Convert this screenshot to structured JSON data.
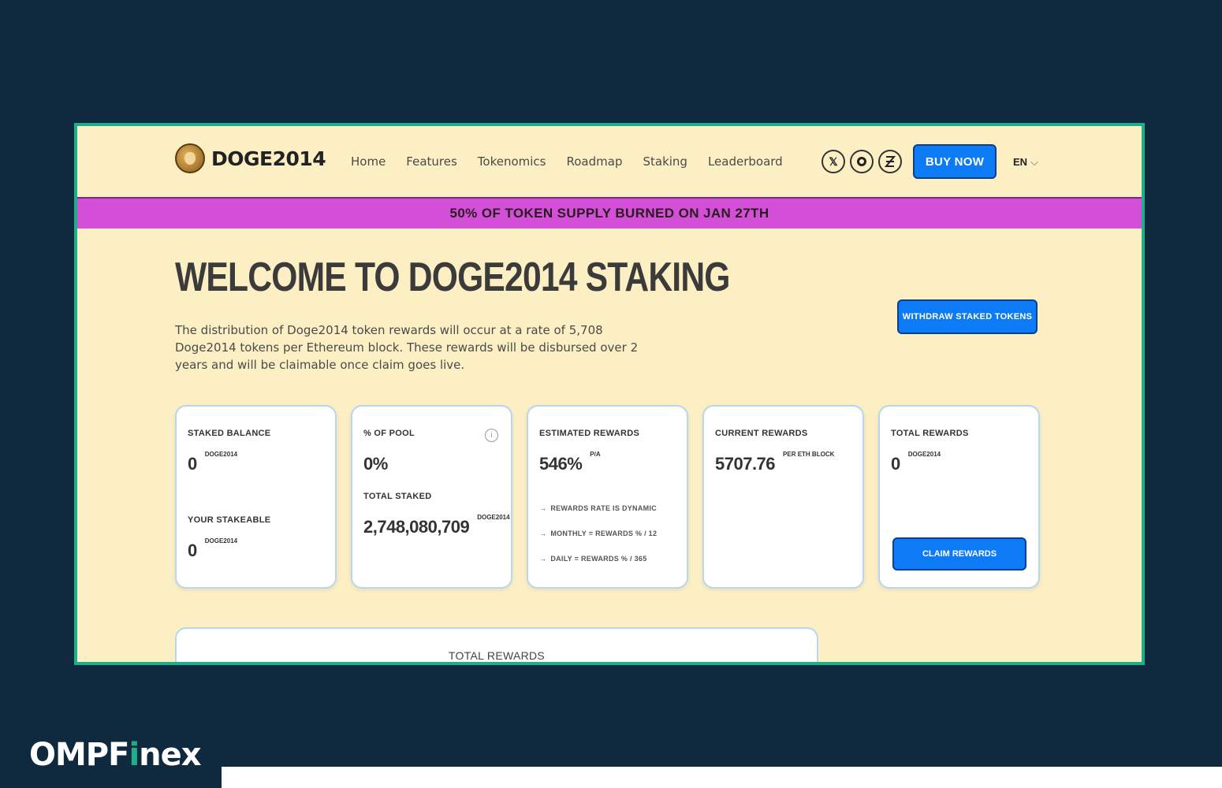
{
  "brand": {
    "logo_text": "DOGE2014"
  },
  "nav": {
    "items": [
      "Home",
      "Features",
      "Tokenomics",
      "Roadmap",
      "Staking",
      "Leaderboard"
    ]
  },
  "socials": [
    "x-icon",
    "coin-icon",
    "logo-icon"
  ],
  "header": {
    "buy_label": "BUY NOW",
    "language": "EN"
  },
  "banner": {
    "text": "50% OF TOKEN SUPPLY BURNED ON JAN 27TH"
  },
  "main": {
    "title": "WELCOME TO DOGE2014 STAKING",
    "description": "The distribution of Doge2014 token rewards will occur at a rate of 5,708 Doge2014 tokens per Ethereum block. These rewards will be disbursed over 2 years and will be claimable once claim goes live.",
    "withdraw_label": "WITHDRAW STAKED TOKENS"
  },
  "cards": {
    "staked": {
      "label": "STAKED BALANCE",
      "value": "0",
      "unit": "DOGE2014",
      "label2": "YOUR STAKEABLE",
      "value2": "0",
      "unit2": "DOGE2014"
    },
    "pool": {
      "label": "% OF POOL",
      "value": "0%",
      "label2": "TOTAL STAKED",
      "value2": "2,748,080,709",
      "unit2": "DOGE2014"
    },
    "estimated": {
      "label": "ESTIMATED REWARDS",
      "value": "546%",
      "unit": "P/A",
      "bullets": [
        "REWARDS RATE IS DYNAMIC",
        "MONTHLY = REWARDS % / 12",
        "DAILY = REWARDS % / 365"
      ]
    },
    "current": {
      "label": "CURRENT REWARDS",
      "value": "5707.76",
      "unit": "PER ETH BLOCK"
    },
    "total": {
      "label": "TOTAL REWARDS",
      "value": "0",
      "unit": "DOGE2014",
      "claim_label": "CLAIM REWARDS"
    }
  },
  "bottom": {
    "label": "TOTAL REWARDS"
  },
  "watermark": {
    "prefix": "OMPF",
    "i": "i",
    "suffix": "nex"
  },
  "colors": {
    "background": "#0f2a3f",
    "page": "#fdefc4",
    "accent": "#0d7bf5",
    "banner": "#d44fd8",
    "frame": "#1fae8a"
  }
}
